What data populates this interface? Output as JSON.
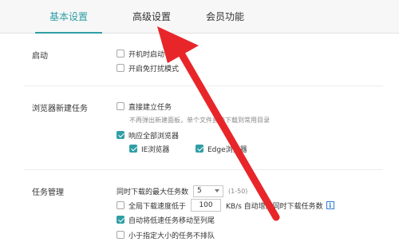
{
  "tabs": [
    {
      "label": "基本设置",
      "active": true
    },
    {
      "label": "高级设置",
      "active": false
    },
    {
      "label": "会员功能",
      "active": false
    }
  ],
  "startup": {
    "title": "启动",
    "options": [
      {
        "label": "开机时启动",
        "checked": false
      },
      {
        "label": "开启免打扰模式",
        "checked": false
      }
    ]
  },
  "new_task": {
    "title": "浏览器新建任务",
    "direct_create": {
      "label": "直接建立任务",
      "checked": false
    },
    "hint": "不再弹出新建面板，单个文件直接下载到常用目录",
    "respond_all": {
      "label": "响应全部浏览器",
      "checked": true
    },
    "browsers": [
      {
        "label": "IE浏览器",
        "checked": true
      },
      {
        "label": "Edge浏览器",
        "checked": true
      }
    ]
  },
  "task_mgmt": {
    "title": "任务管理",
    "max_downloads": {
      "label": "同时下载的最大任务数",
      "value": "5",
      "range": "(1-50)"
    },
    "low_speed": {
      "label": "全局下载速度低于",
      "value": "100",
      "suffix": "KB/s 自动增加同时下载任务数",
      "checked": false
    },
    "move_low": {
      "label": "自动将低速任务移动至列尾",
      "checked": true
    },
    "no_queue": {
      "label": "小于指定大小的任务不排队",
      "checked": false
    }
  },
  "annotation": {
    "color": "#e8262a",
    "type": "red-arrow-pointing-to-tab"
  },
  "colors": {
    "accent": "#2f9fa5",
    "info": "#2f7ed8"
  }
}
